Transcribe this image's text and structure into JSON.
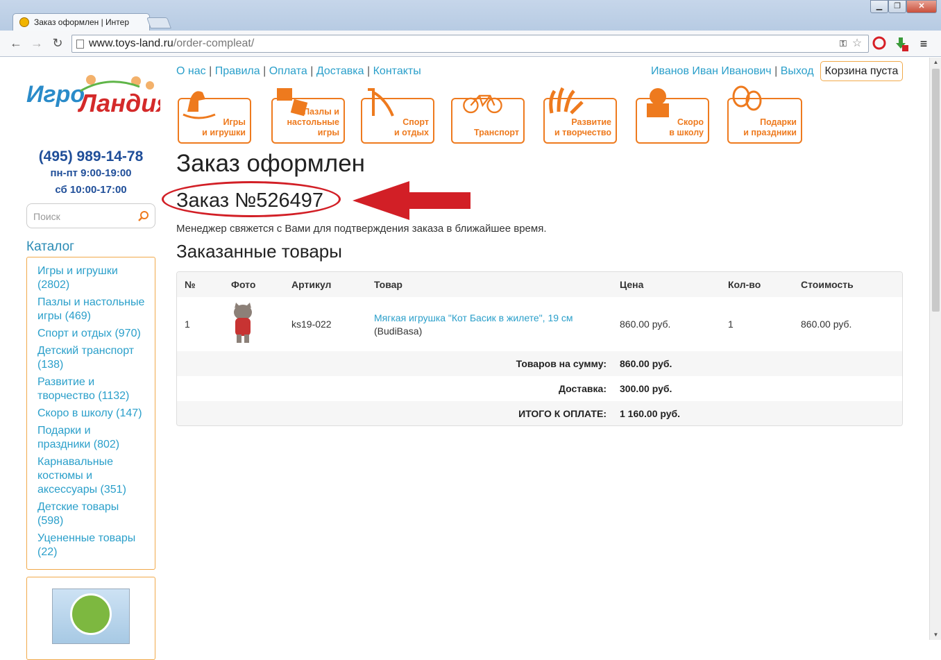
{
  "browser": {
    "tab_title": "Заказ оформлен | Интер",
    "url_domain": "www.toys-land.ru",
    "url_path": "/order-compleat/",
    "window_buttons": [
      "▁",
      "❐",
      "✕"
    ]
  },
  "site": {
    "logo_text": "ИгроЛандия",
    "phone": "(495) 989-14-78",
    "hours_weekday": "пн-пт 9:00-19:00",
    "hours_saturday": "сб 10:00-17:00",
    "search_placeholder": "Поиск",
    "catalog_title": "Каталог",
    "catalog_items": [
      "Игры и игрушки (2802)",
      "Пазлы и настольные игры (469)",
      "Спорт и отдых (970)",
      "Детский транспорт (138)",
      "Развитие и творчество (1132)",
      "Скоро в школу (147)",
      "Подарки и праздники (802)",
      "Карнавальные костюмы и аксессуары (351)",
      "Детские товары (598)",
      "Уцененные товары (22)"
    ],
    "top_menu": [
      "О нас",
      "Правила",
      "Оплата",
      "Доставка",
      "Контакты"
    ],
    "menu_separator": "|",
    "user_name": "Иванов Иван Иванович",
    "logout": "Выход",
    "cart": "Корзина пуста",
    "categories": [
      "Игры\nи игрушки",
      "Пазлы и\nнастольные игры",
      "Спорт\nи отдых",
      "Транспорт",
      "Развитие\nи творчество",
      "Скоро\nв школу",
      "Подарки\nи праздники"
    ]
  },
  "order": {
    "heading": "Заказ оформлен",
    "number": "Заказ №526497",
    "notice": "Менеджер свяжется с Вами для подтверждения заказа в ближайшее время.",
    "items_heading": "Заказанные товары",
    "columns": [
      "№",
      "Фото",
      "Артикул",
      "Товар",
      "Цена",
      "Кол-во",
      "Стоимость"
    ],
    "item": {
      "index": "1",
      "article": "ks19-022",
      "name": "Мягкая игрушка \"Кот Басик в жилете\", 19 см",
      "brand": "(BudiBasa)",
      "price": "860.00 руб.",
      "qty": "1",
      "total": "860.00 руб."
    },
    "subtotal_label": "Товаров на сумму:",
    "subtotal": "860.00 руб.",
    "delivery_label": "Доставка:",
    "delivery": "300.00 руб.",
    "grand_label": "ИТОГО К ОПЛАТЕ:",
    "grand": "1 160.00 руб."
  },
  "colors": {
    "link": "#2a9fca",
    "accent": "#ee7a1e",
    "annotation": "#d21f26"
  }
}
